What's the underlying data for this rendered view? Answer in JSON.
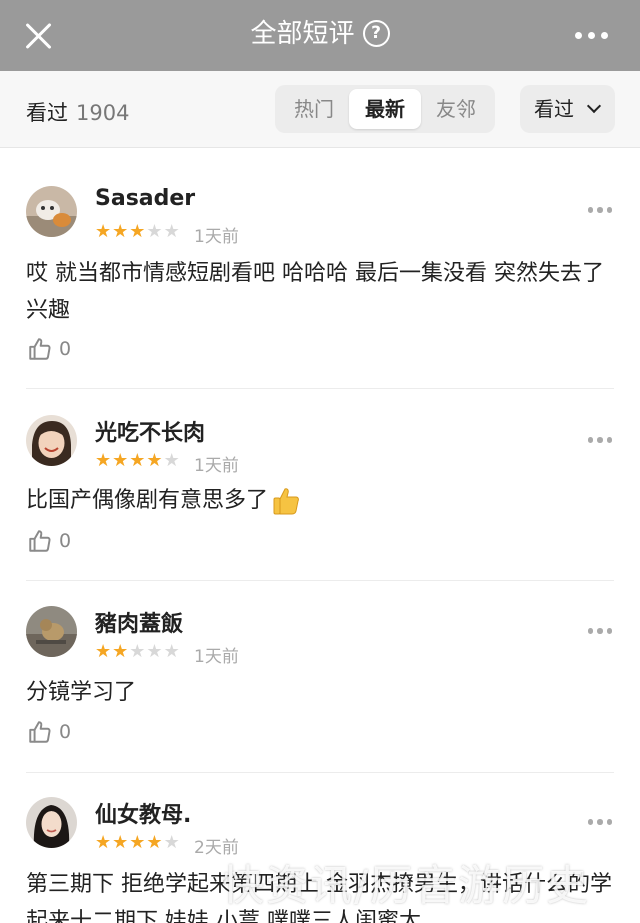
{
  "header": {
    "title": "全部短评",
    "help_symbol": "?"
  },
  "filter": {
    "seen_label": "看过",
    "seen_count": "1904",
    "tabs": [
      "热门",
      "最新",
      "友邻"
    ],
    "active_tab": "最新",
    "dropdown_label": "看过"
  },
  "comments": [
    {
      "user": "Sasader",
      "rating": 3,
      "time": "1天前",
      "text": "哎 就当都市情感短剧看吧 哈哈哈 最后一集没看 突然失去了兴趣",
      "likes": "0"
    },
    {
      "user": "光吃不长肉",
      "rating": 4,
      "time": "1天前",
      "text": "比国产偶像剧有意思多了",
      "emoji": "thumbs-up",
      "likes": "0"
    },
    {
      "user": "豬肉蓋飯",
      "rating": 2,
      "time": "1天前",
      "text": "分镜学习了",
      "likes": "0"
    },
    {
      "user": "仙女教母.",
      "rating": 4,
      "time": "2天前",
      "text": "第三期下 拒绝学起来第四期上 金羽杰撩男生，讲话什么的学起来十二期下 娃娃 小蒿 噗噗三人闺蜜太"
    }
  ],
  "watermark": "快资讯/历音游历史",
  "colors": {
    "topbar": "#9a9a9a",
    "star_on": "#f5a623",
    "star_off": "#d8d8d8"
  }
}
